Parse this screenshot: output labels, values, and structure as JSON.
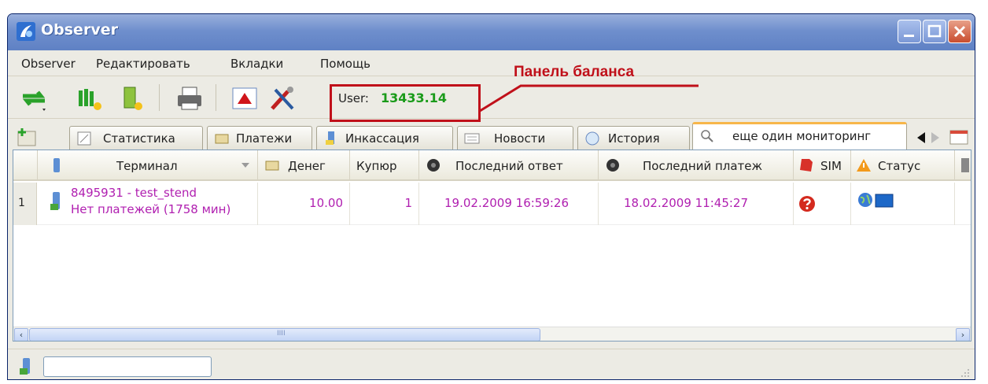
{
  "window": {
    "title": "Observer"
  },
  "menu": [
    "Observer",
    "Редактировать",
    "Вкладки",
    "Помощь"
  ],
  "balance": {
    "label": "User:",
    "value": "13433.14"
  },
  "tabs": [
    {
      "label": "Статистика"
    },
    {
      "label": "Платежи"
    },
    {
      "label": "Инкассация"
    },
    {
      "label": "Новости"
    },
    {
      "label": "История"
    },
    {
      "label": "еще один мониторинг"
    }
  ],
  "grid": {
    "columns": [
      "Терминал",
      "Денег",
      "Купюр",
      "Последний ответ",
      "Последний платеж",
      "SIM",
      "Статус"
    ],
    "rows": [
      {
        "num": "1",
        "terminal": "8495931 - test_stend",
        "subtitle": "Нет платежей (1758 мин)",
        "money": "10.00",
        "bills": "1",
        "last_response": "19.02.2009 16:59:26",
        "last_payment": "18.02.2009 11:45:27"
      }
    ],
    "scroll_marker": "IIII"
  },
  "status_input": {
    "value": ""
  },
  "annotation": {
    "label": "Панель баланса"
  },
  "icons": [
    "app-icon",
    "refresh-icon",
    "terminal-add-icon",
    "terminal-edit-icon",
    "printer-icon",
    "chart-up-icon",
    "tools-icon",
    "add-tab-icon",
    "question-icon",
    "globe-icon",
    "monitor-icon",
    "warning-icon",
    "sim-icon",
    "clock-icon"
  ],
  "colors": {
    "accent_value": "#1a9b1a",
    "row_text": "#b01fb0",
    "annotation": "#c0101a",
    "title_bar": "#6f8fcd"
  }
}
